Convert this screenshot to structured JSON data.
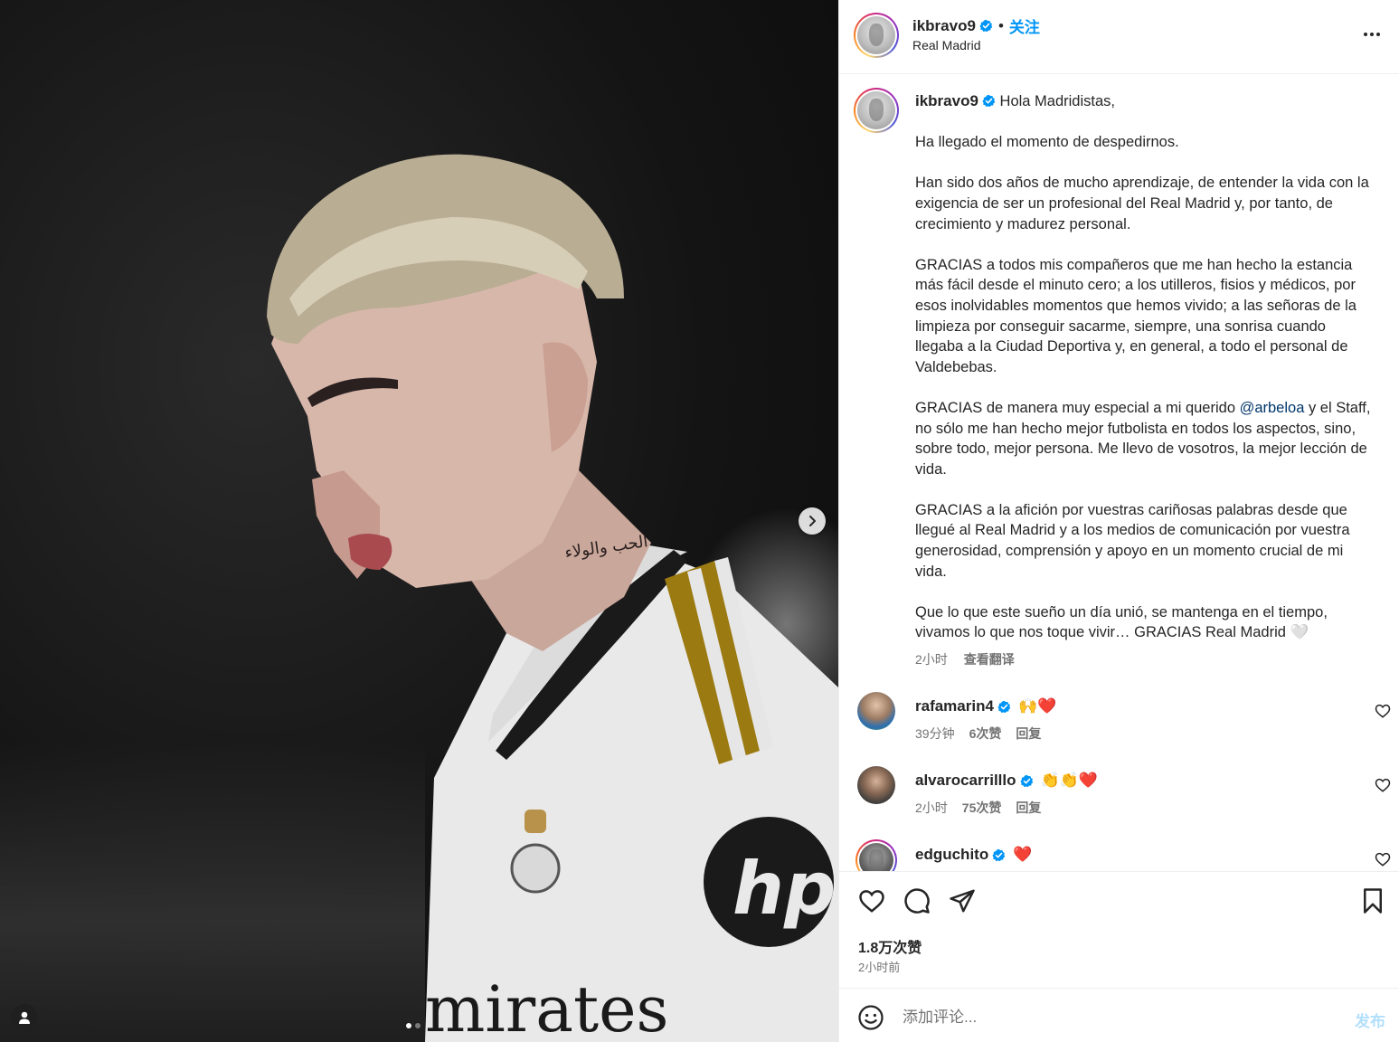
{
  "media": {
    "neck_tattoo": "الحب والولاء",
    "sponsor_text": "mirates",
    "dots_count": 2,
    "active_dot": 0
  },
  "header": {
    "username": "ikbravo9",
    "follow_label": "关注",
    "separator": "•",
    "location": "Real Madrid"
  },
  "caption": {
    "username": "ikbravo9",
    "greeting": "Hola Madridistas,",
    "p1": "Ha llegado el momento de despedirnos.",
    "p2": "Han sido dos años de mucho aprendizaje, de entender la vida con la exigencia de ser un profesional del Real Madrid y, por tanto, de crecimiento y madurez personal.",
    "p3": "GRACIAS a todos mis compañeros que me han hecho la estancia más fácil desde el minuto cero; a los utilleros, fisios y médicos, por esos inolvidables momentos que hemos vivido; a las señoras de la limpieza por conseguir sacarme, siempre, una sonrisa cuando llegaba a la Ciudad Deportiva y, en general, a todo el personal de Valdebebas.",
    "p4_before": "GRACIAS de manera muy especial a mi querido ",
    "p4_mention": "@arbeloa",
    "p4_after": " y el Staff, no sólo me han hecho mejor futbolista en todos los aspectos, sino, sobre todo, mejor persona. Me llevo de vosotros, la mejor lección de vida.",
    "p5": "GRACIAS a la afición por vuestras cariñosas palabras desde que llegué al Real Madrid y a los medios de comunicación por vuestra generosidad, comprensión y apoyo en un momento crucial de mi vida.",
    "p6": "Que lo que este sueño un día unió, se mantenga en el tiempo, vivamos lo que nos toque vivir… GRACIAS Real Madrid 🤍",
    "time": "2小时",
    "translate_label": "查看翻译"
  },
  "comments": [
    {
      "username": "rafamarin4",
      "text": "🙌❤️",
      "time": "39分钟",
      "likes": "6次赞",
      "reply": "回复"
    },
    {
      "username": "alvarocarrilllo",
      "text": "👏👏❤️",
      "time": "2小时",
      "likes": "75次赞",
      "reply": "回复"
    },
    {
      "username": "edguchito",
      "text": "❤️",
      "time": "",
      "likes": "",
      "reply": ""
    }
  ],
  "actions": {
    "likes_count": "1.8万次赞",
    "posted_ago": "2小时前"
  },
  "composer": {
    "placeholder": "添加评论...",
    "post_label": "发布"
  },
  "colors": {
    "accent": "#0095f6",
    "text": "#262626",
    "muted": "#737373",
    "mention": "#00376b",
    "border": "#efefef"
  }
}
